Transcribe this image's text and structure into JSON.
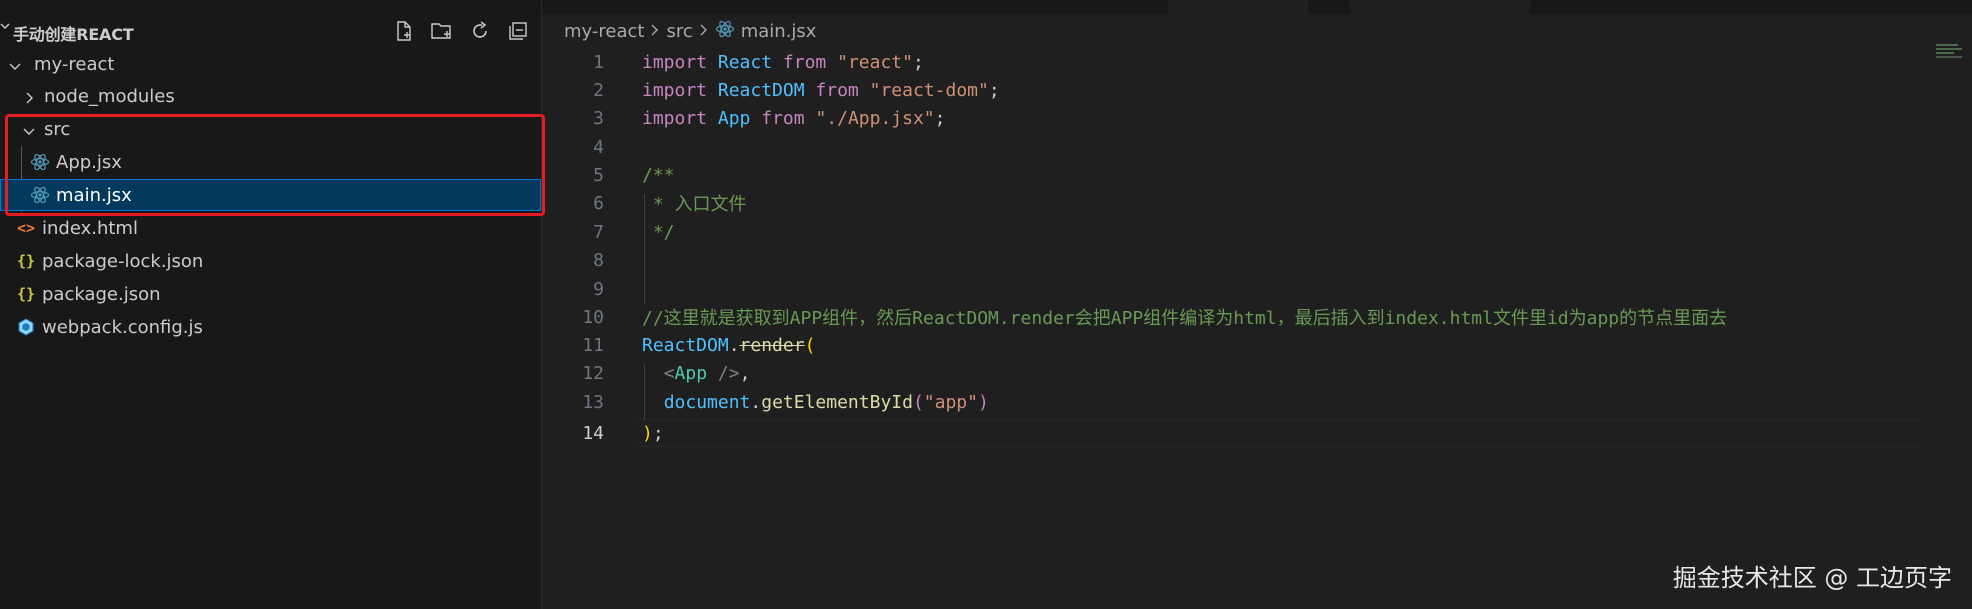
{
  "sidebar": {
    "title": "手动创建REACT",
    "actions": [
      "new-file-icon",
      "new-folder-icon",
      "refresh-icon",
      "collapse-all-icon"
    ],
    "items": [
      {
        "label": "my-react",
        "kind": "folder-open"
      },
      {
        "label": "node_modules",
        "kind": "folder-closed"
      },
      {
        "label": "src",
        "kind": "folder-open"
      },
      {
        "label": "App.jsx",
        "kind": "react"
      },
      {
        "label": "main.jsx",
        "kind": "react"
      },
      {
        "label": "index.html",
        "kind": "html"
      },
      {
        "label": "package-lock.json",
        "kind": "json"
      },
      {
        "label": "package.json",
        "kind": "json"
      },
      {
        "label": "webpack.config.js",
        "kind": "webpack"
      }
    ]
  },
  "breadcrumb": {
    "part1": "my-react",
    "part2": "src",
    "file": "main.jsx"
  },
  "colors": {
    "keyword": "#c586c0",
    "identifier": "#4fc1ff",
    "string": "#ce9178",
    "comment": "#6a9955",
    "selection": "#04395e",
    "highlight_box": "#e51c23"
  },
  "editor": {
    "line_numbers": [
      "1",
      "2",
      "3",
      "4",
      "5",
      "6",
      "7",
      "8",
      "9",
      "10",
      "11",
      "12",
      "13",
      "14"
    ],
    "l1": {
      "kw1": "import",
      "id": "React",
      "kw2": "from",
      "str": "\"react\"",
      "end": ";"
    },
    "l2": {
      "kw1": "import",
      "id": "ReactDOM",
      "kw2": "from",
      "str": "\"react-dom\"",
      "end": ";"
    },
    "l3": {
      "kw1": "import",
      "id": "App",
      "kw2": "from",
      "str": "\"./App.jsx\"",
      "end": ";"
    },
    "l5": "/**",
    "l6": " * 入口文件",
    "l7": " */",
    "l10": "//这里就是获取到APP组件，然后ReactDOM.render会把APP组件编译为html，最后插入到index.html文件里id为app的节点里面去",
    "l11": {
      "obj": "ReactDOM",
      "dot": ".",
      "method": "render",
      "paren": "("
    },
    "l12": {
      "open": "<",
      "tag": "App",
      "close": " />",
      "comma": ","
    },
    "l13": {
      "obj": "document",
      "dot": ".",
      "fn": "getElementById",
      "open": "(",
      "str": "\"app\"",
      "close": ")"
    },
    "l14": {
      "paren": ")",
      "semi": ";"
    }
  },
  "watermark": "掘金技术社区 @ 工边页字"
}
